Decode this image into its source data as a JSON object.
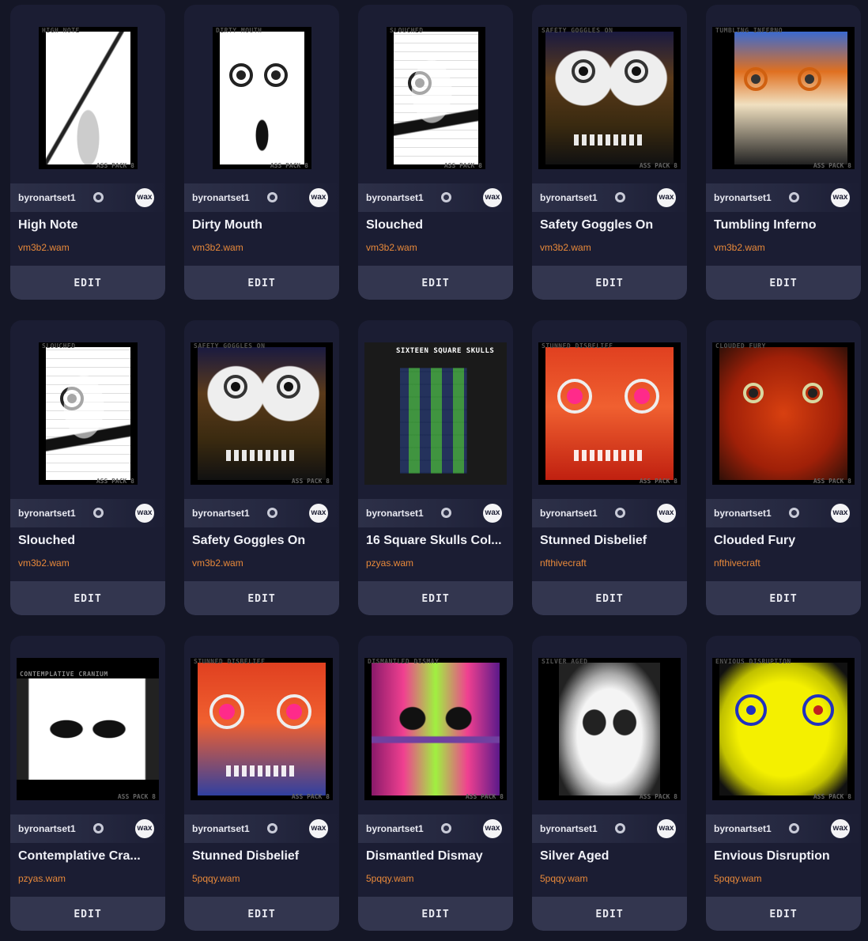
{
  "cards": [
    {
      "owner": "byronartset1",
      "title": "High Note",
      "collection": "vm3b2.wam",
      "edit_label": "EDIT",
      "art_top": "HIGH NOTE",
      "art_bottom": "ASS PACK 8"
    },
    {
      "owner": "byronartset1",
      "title": "Dirty Mouth",
      "collection": "vm3b2.wam",
      "edit_label": "EDIT",
      "art_top": "DIRTY MOUTH",
      "art_bottom": "ASS PACK 8"
    },
    {
      "owner": "byronartset1",
      "title": "Slouched",
      "collection": "vm3b2.wam",
      "edit_label": "EDIT",
      "art_top": "SLOUCHED",
      "art_bottom": "ASS PACK 8"
    },
    {
      "owner": "byronartset1",
      "title": "Safety Goggles On",
      "collection": "vm3b2.wam",
      "edit_label": "EDIT",
      "art_top": "SAFETY GOGGLES ON",
      "art_bottom": "ASS PACK 8"
    },
    {
      "owner": "byronartset1",
      "title": "Tumbling Inferno",
      "collection": "vm3b2.wam",
      "edit_label": "EDIT",
      "art_top": "TUMBLING INFERNO",
      "art_bottom": "ASS PACK 8"
    },
    {
      "owner": "byronartset1",
      "title": "Slouched",
      "collection": "vm3b2.wam",
      "edit_label": "EDIT",
      "art_top": "SLOUCHED",
      "art_bottom": "ASS PACK 8"
    },
    {
      "owner": "byronartset1",
      "title": "Safety Goggles On",
      "collection": "vm3b2.wam",
      "edit_label": "EDIT",
      "art_top": "SAFETY GOGGLES ON",
      "art_bottom": "ASS PACK 8"
    },
    {
      "owner": "byronartset1",
      "title": "16 Square Skulls Col...",
      "collection": "pzyas.wam",
      "edit_label": "EDIT",
      "art_top": "SIXTEEN SQUARE SKULLS",
      "art_bottom": ""
    },
    {
      "owner": "byronartset1",
      "title": "Stunned Disbelief",
      "collection": "nfthivecraft",
      "edit_label": "EDIT",
      "art_top": "STUNNED DISBELIEF",
      "art_bottom": "ASS PACK 8"
    },
    {
      "owner": "byronartset1",
      "title": "Clouded Fury",
      "collection": "nfthivecraft",
      "edit_label": "EDIT",
      "art_top": "CLOUDED FURY",
      "art_bottom": "ASS PACK 8"
    },
    {
      "owner": "byronartset1",
      "title": "Contemplative Cra...",
      "collection": "pzyas.wam",
      "edit_label": "EDIT",
      "art_top": "CONTEMPLATIVE CRANIUM",
      "art_bottom": "ASS PACK 8"
    },
    {
      "owner": "byronartset1",
      "title": "Stunned Disbelief",
      "collection": "5pqqy.wam",
      "edit_label": "EDIT",
      "art_top": "STUNNED DISBELIEF",
      "art_bottom": "ASS PACK 8"
    },
    {
      "owner": "byronartset1",
      "title": "Dismantled Dismay",
      "collection": "5pqqy.wam",
      "edit_label": "EDIT",
      "art_top": "DISMANTLED DISMAY",
      "art_bottom": "ASS PACK 8"
    },
    {
      "owner": "byronartset1",
      "title": "Silver Aged",
      "collection": "5pqqy.wam",
      "edit_label": "EDIT",
      "art_top": "SILVER AGED",
      "art_bottom": "ASS PACK 8"
    },
    {
      "owner": "byronartset1",
      "title": "Envious Disruption",
      "collection": "5pqqy.wam",
      "edit_label": "EDIT",
      "art_top": "ENVIOUS DISRUPTION",
      "art_bottom": "ASS PACK 8"
    }
  ],
  "icons": {
    "verified": "verified-badge-icon",
    "wax": "wax-logo-icon"
  },
  "colors": {
    "background": "#141626",
    "card": "#1b1d33",
    "edit_button": "#33364f",
    "collection_text": "#e8893a"
  }
}
